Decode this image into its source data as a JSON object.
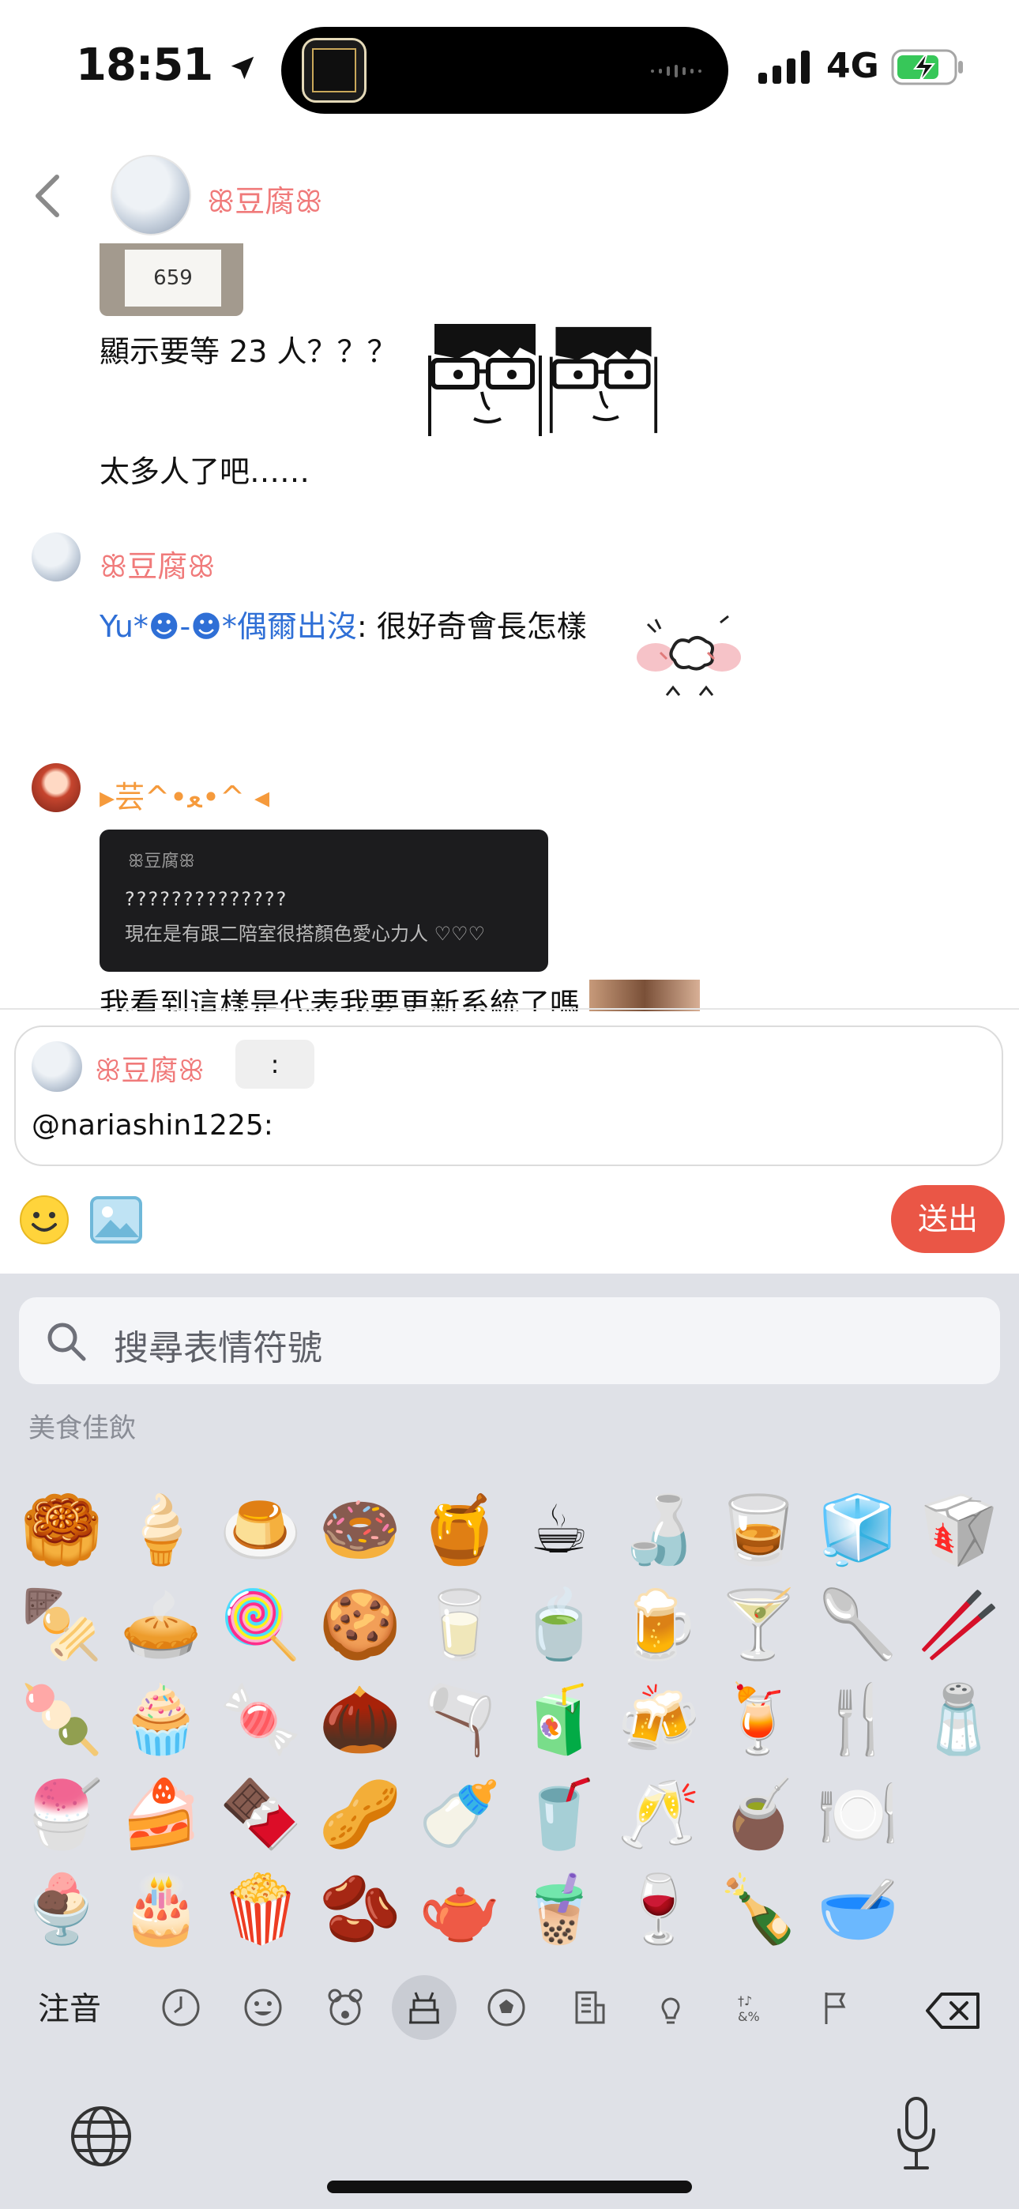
{
  "status_bar": {
    "time": "18:51",
    "network": "4G"
  },
  "header": {
    "name": "ꕥ豆腐ꕥ"
  },
  "chat": {
    "msg1_text": "顯示要等 23 人？？？",
    "ticket_number": "659",
    "msg2_text": "太多人了吧……",
    "msg3_user": "ꕥ豆腐ꕥ",
    "msg3_mention": "Yu*☻-☻*偶爾出沒",
    "msg3_text": ": 很好奇會長怎樣",
    "msg4_user": "▸芸^•ﻌ•^ ◂",
    "screenshot_user": "ꕥ豆腐ꕥ",
    "screenshot_line2": "??????????????",
    "screenshot_line3": "現在是有跟二陪室很搭顏色愛心力人 ♡♡♡",
    "msg4_text": "我看到這樣是代表我要更新系統了嗎"
  },
  "composer": {
    "reply_name": "ꕥ豆腐ꕥ",
    "reply_pill": ":",
    "text": "@nariashin1225:",
    "send_label": "送出"
  },
  "keyboard": {
    "search_placeholder": "搜尋表情符號",
    "category": "美食佳飲",
    "emoji_rows": [
      [
        "🥮",
        "🍦",
        "🍮",
        "🍩",
        "🍯",
        "☕",
        "🍶",
        "🥃",
        "🧊",
        "🥡"
      ],
      [
        "🍢",
        "🥧",
        "🍭",
        "🍪",
        "🥛",
        "🍵",
        "🍺",
        "🍸",
        "🥄",
        "🥢"
      ],
      [
        "🍡",
        "🧁",
        "🍬",
        "🌰",
        "🫗",
        "🧃",
        "🍻",
        "🍹",
        "🍴",
        "🧂"
      ],
      [
        "🍧",
        "🍰",
        "🍫",
        "🥜",
        "🍼",
        "🥤",
        "🥂",
        "🧉",
        "🍽️",
        ""
      ],
      [
        "🍨",
        "🎂",
        "🍿",
        "🫘",
        "🫖",
        "🧋",
        "🍷",
        "🍾",
        "🥣",
        ""
      ]
    ],
    "zhuyin_label": "注音",
    "tabs": [
      "clock-icon",
      "smiley-icon",
      "bear-icon",
      "food-icon",
      "ball-icon",
      "building-icon",
      "bulb-icon",
      "symbols-icon",
      "flag-icon"
    ],
    "active_tab": "food-icon"
  }
}
